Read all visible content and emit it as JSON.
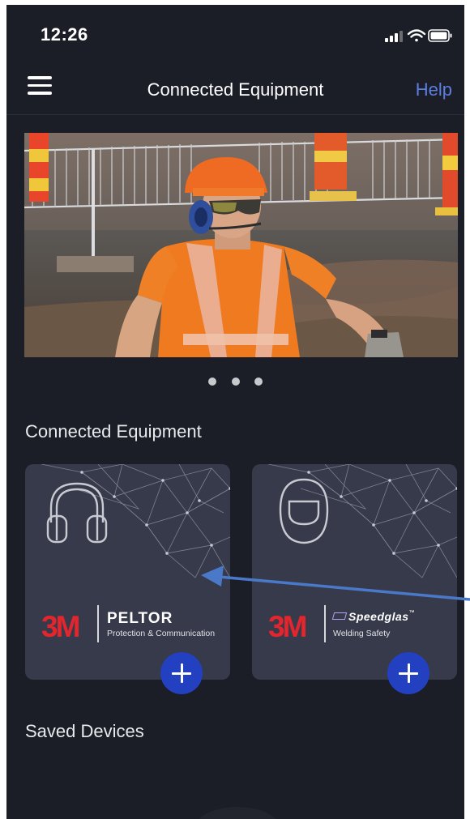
{
  "status_bar": {
    "time": "12:26",
    "icons": [
      "signal-icon",
      "wifi-icon",
      "battery-icon"
    ]
  },
  "nav": {
    "menu_icon": "hamburger-menu-icon",
    "title": "Connected Equipment",
    "help_label": "Help"
  },
  "carousel": {
    "page_count": 3,
    "active_index": 0
  },
  "connected_section": {
    "heading": "Connected Equipment",
    "devices": [
      {
        "icon": "headset-icon",
        "brand_mark": "3M",
        "product": "PELTOR",
        "subtitle": "Protection & Communication",
        "add_icon": "plus-icon"
      },
      {
        "icon": "welding-helmet-icon",
        "brand_mark": "3M",
        "product": "Speedglas",
        "trademark": "™",
        "subtitle": "Welding Safety",
        "add_icon": "plus-icon"
      }
    ]
  },
  "saved_section": {
    "heading": "Saved Devices"
  },
  "colors": {
    "background": "#1b1e26",
    "card": "#373a4b",
    "accent_link": "#5b7ee0",
    "add_button": "#2240c0",
    "brand_red": "#e3262d",
    "annotation_arrow": "#4a79c9"
  }
}
